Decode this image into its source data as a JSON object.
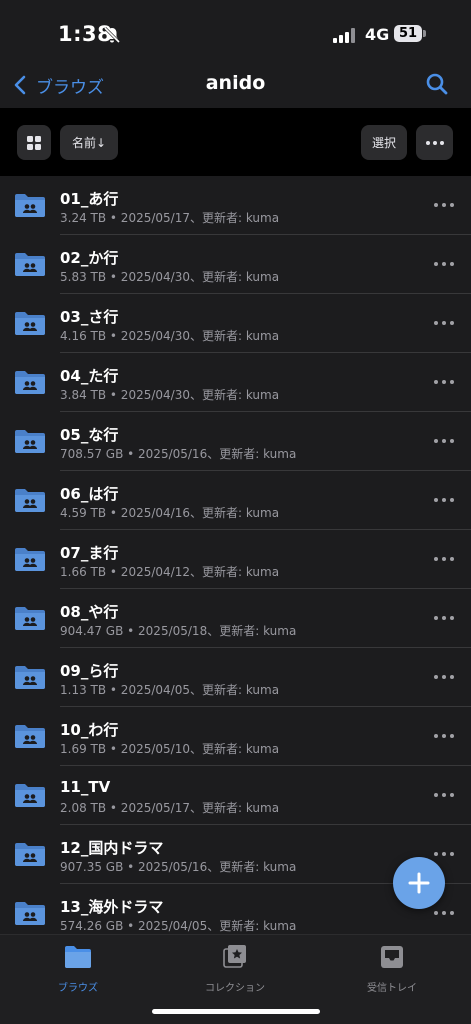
{
  "status": {
    "time": "1:38",
    "network": "4G",
    "battery": "51"
  },
  "nav": {
    "back_label": "ブラウズ",
    "title": "anido"
  },
  "toolbar": {
    "sort_label": "名前↓",
    "select_label": "選択"
  },
  "files": [
    {
      "name": "01_あ行",
      "meta": "3.24 TB • 2025/05/17、更新者: kuma"
    },
    {
      "name": "02_か行",
      "meta": "5.83 TB • 2025/04/30、更新者: kuma"
    },
    {
      "name": "03_さ行",
      "meta": "4.16 TB • 2025/04/30、更新者: kuma"
    },
    {
      "name": "04_た行",
      "meta": "3.84 TB • 2025/04/30、更新者: kuma"
    },
    {
      "name": "05_な行",
      "meta": "708.57 GB • 2025/05/16、更新者: kuma"
    },
    {
      "name": "06_は行",
      "meta": "4.59 TB • 2025/04/16、更新者: kuma"
    },
    {
      "name": "07_ま行",
      "meta": "1.66 TB • 2025/04/12、更新者: kuma"
    },
    {
      "name": "08_や行",
      "meta": "904.47 GB • 2025/05/18、更新者: kuma"
    },
    {
      "name": "09_ら行",
      "meta": "1.13 TB • 2025/04/05、更新者: kuma"
    },
    {
      "name": "10_わ行",
      "meta": "1.69 TB • 2025/05/10、更新者: kuma"
    },
    {
      "name": "11_TV",
      "meta": "2.08 TB • 2025/05/17、更新者: kuma"
    },
    {
      "name": "12_国内ドラマ",
      "meta": "907.35 GB • 2025/05/16、更新者: kuma"
    },
    {
      "name": "13_海外ドラマ",
      "meta": "574.26 GB • 2025/04/05、更新者: kuma"
    }
  ],
  "tabs": [
    {
      "label": "ブラウズ",
      "icon": "folder-icon",
      "active": true
    },
    {
      "label": "コレクション",
      "icon": "collection-icon",
      "active": false
    },
    {
      "label": "受信トレイ",
      "icon": "inbox-icon",
      "active": false
    }
  ],
  "colors": {
    "accent": "#4a8fe7",
    "folder": "#5b94dd",
    "fab": "#6aa3e8",
    "list_bg": "#1c1c1e"
  }
}
